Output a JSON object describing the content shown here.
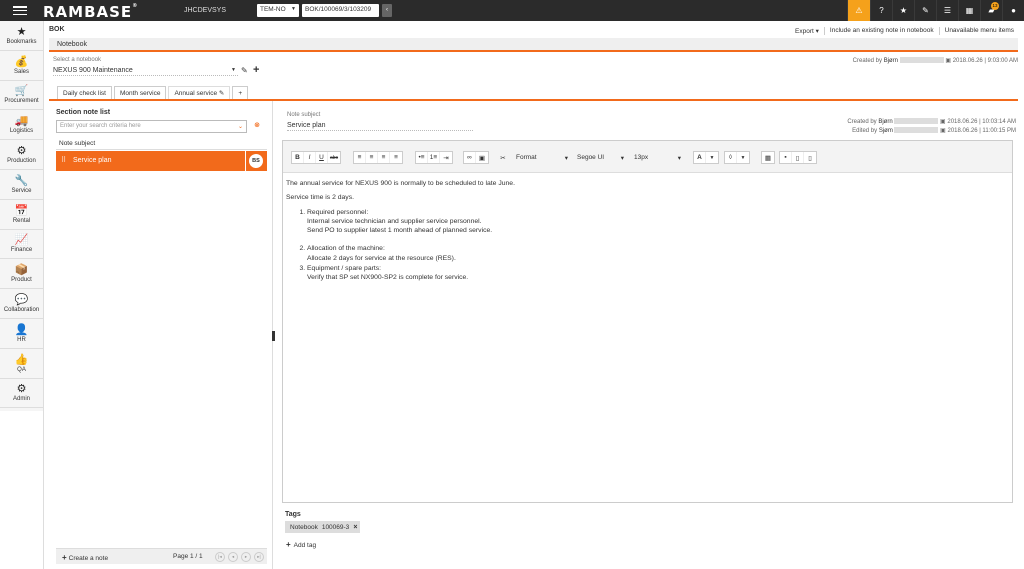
{
  "topbar": {
    "logo": "RAMBASE",
    "logo_mark": "®",
    "system": "JHCDEVSYS",
    "company": "TEM-NO",
    "search_value": "BOK/100069/3/103209",
    "notifications_badge": "13",
    "accent": "#f5a11b"
  },
  "nav": [
    {
      "label": "Bookmarks",
      "icon": "★"
    },
    {
      "label": "Sales",
      "icon": "💰"
    },
    {
      "label": "Procurement",
      "icon": "🛒"
    },
    {
      "label": "Logistics",
      "icon": "🚚"
    },
    {
      "label": "Production",
      "icon": "⚙"
    },
    {
      "label": "Service",
      "icon": "🔧"
    },
    {
      "label": "Rental",
      "icon": "📅"
    },
    {
      "label": "Finance",
      "icon": "📈"
    },
    {
      "label": "Product",
      "icon": "📦"
    },
    {
      "label": "Collaboration",
      "icon": "💬"
    },
    {
      "label": "HR",
      "icon": "👤"
    },
    {
      "label": "QA",
      "icon": "👍"
    },
    {
      "label": "Admin",
      "icon": "⚙"
    }
  ],
  "header": {
    "app_code": "BOK",
    "export": "Export ▾",
    "include_note": "Include an existing note in notebook",
    "unavailable": "Unavailable menu items",
    "tab": "Notebook"
  },
  "notebook": {
    "select_label": "Select a notebook",
    "selected": "NEXUS 900 Maintenance",
    "created_label": "Created by",
    "created_user": "Bjørn",
    "created_date": "2018.06.26 | 9:03:00 AM"
  },
  "tabs": [
    "Daily check list",
    "Month service",
    "Annual service",
    "+"
  ],
  "section": {
    "title": "Section note list",
    "search_placeholder": "Enter your search criteria here",
    "column": "Note subject",
    "rows": [
      {
        "subject": "Service plan",
        "initials": "BS"
      }
    ],
    "create": "Create a note",
    "pager": "Page 1 / 1"
  },
  "note": {
    "subject_label": "Note subject",
    "subject": "Service plan",
    "created_label": "Created by",
    "created_user": "Bjørn",
    "created_date": "2018.06.26 | 10:03:14 AM",
    "edited_label": "Edited by",
    "edited_user": "Sjøm",
    "edited_date": "2018.06.26 | 11:00:15 PM"
  },
  "toolbar": {
    "format": "Format",
    "font": "Segoe UI",
    "size": "13px"
  },
  "content": {
    "p1": "The annual service for NEXUS 900 is normally to be scheduled to late June.",
    "p2": "Service time is 2 days.",
    "items": [
      {
        "title": "Required personnel:",
        "lines": [
          "Internal service technician and supplier service personnel.",
          "Send PO to supplier latest 1 month ahead of planned service."
        ]
      },
      {
        "title": "Allocation of the machine:",
        "lines": [
          "Allocate 2 days for service at the resource (RES)."
        ]
      },
      {
        "title": "Equipment / spare parts:",
        "lines": [
          "Verify that SP set NX900-SP2 is complete for service."
        ]
      }
    ]
  },
  "tags": {
    "label": "Tags",
    "chip_type": "Notebook",
    "chip_value": "100069-3",
    "add": "Add tag"
  }
}
